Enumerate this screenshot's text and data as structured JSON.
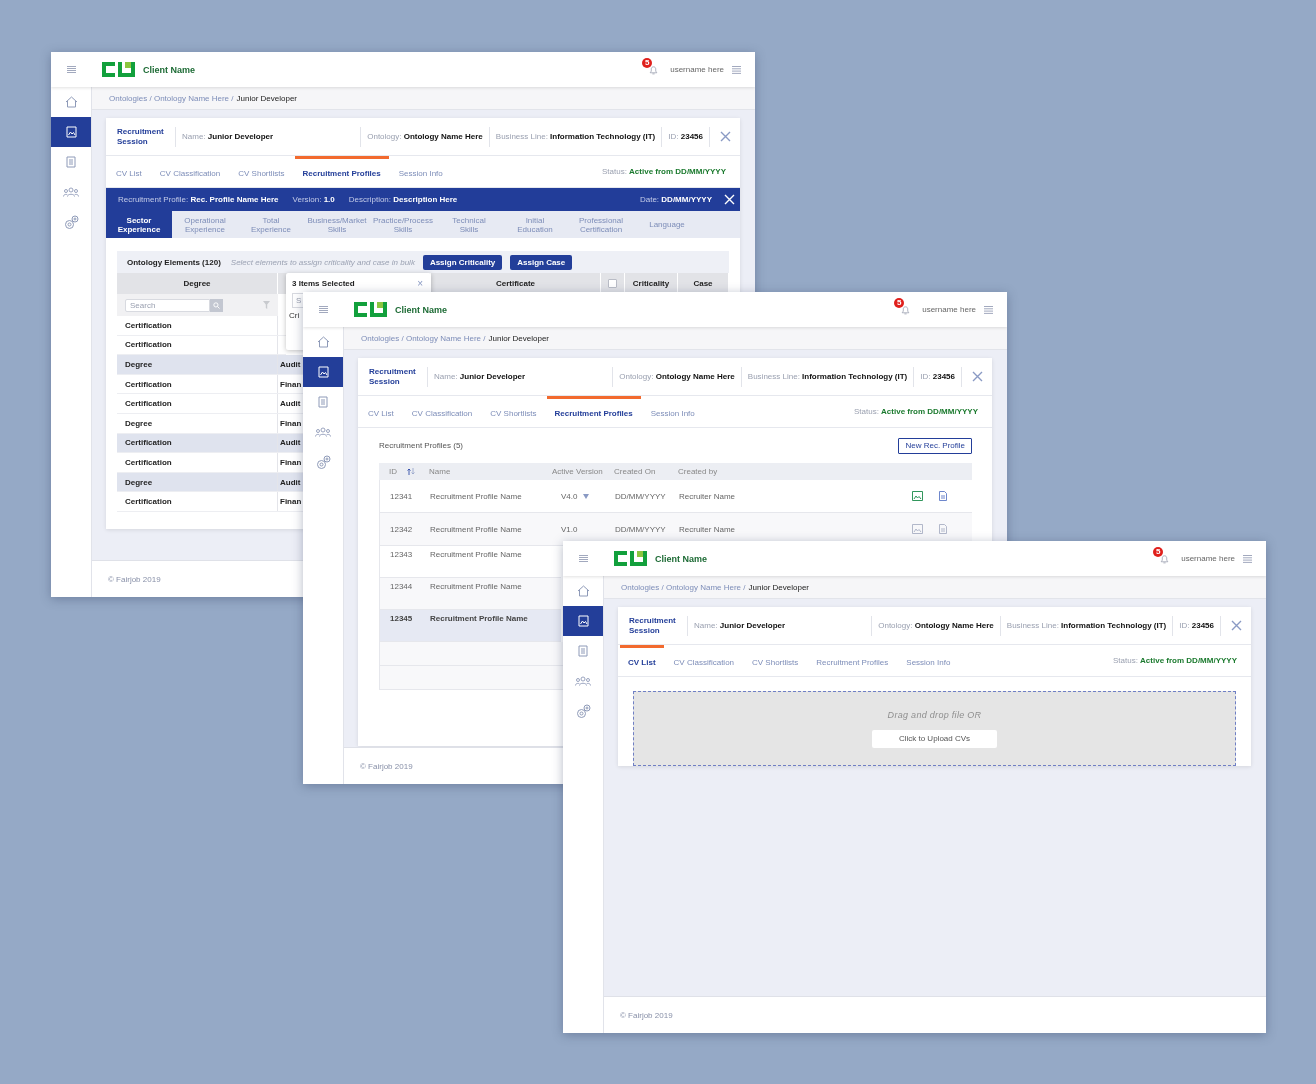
{
  "windows": [
    {
      "kind": "profile_detail",
      "header": {
        "client_name": "Client Name",
        "notifications": "5",
        "username": "username here"
      },
      "sidebar": [
        {
          "kind": "home",
          "selected": false
        },
        {
          "kind": "profile",
          "selected": true
        },
        {
          "kind": "document",
          "selected": false
        },
        {
          "kind": "people",
          "selected": false
        },
        {
          "kind": "settings",
          "selected": false
        }
      ],
      "breadcrumb": {
        "path": "Ontologies / Ontology Name Here /",
        "current": "Junior Developer"
      },
      "session": {
        "title": "Recruitment Session",
        "fields": [
          {
            "label": "Name:",
            "value": "Junior Developer"
          },
          {
            "label": "Ontology:",
            "value": "Ontology Name Here"
          },
          {
            "label": "Business Line:",
            "value": "Information Technology (IT)"
          },
          {
            "label": "ID:",
            "value": "23456"
          }
        ]
      },
      "tabs": [
        {
          "label": "CV List",
          "selected": false
        },
        {
          "label": "CV Classification",
          "selected": false
        },
        {
          "label": "CV Shortlists",
          "selected": false
        },
        {
          "label": "Recruitment Profiles",
          "selected": true
        },
        {
          "label": "Session Info",
          "selected": false
        }
      ],
      "status": {
        "label": "Status:",
        "value": "Active from DD/MM/YYYY"
      },
      "profile_bar": {
        "fields": [
          {
            "label": "Recruitment Profile:",
            "value": "Rec. Profile Name Here"
          },
          {
            "label": "Version:",
            "value": "1.0"
          },
          {
            "label": "Description:",
            "value": "Description Here"
          }
        ],
        "date": {
          "label": "Date:",
          "value": "DD/MM/YYYY"
        }
      },
      "sub_tabs": [
        {
          "label": "Sector Experience",
          "selected": true
        },
        {
          "label": "Operational Experience",
          "selected": false
        },
        {
          "label": "Total Experience",
          "selected": false
        },
        {
          "label": "Business/Market Skills",
          "selected": false
        },
        {
          "label": "Practice/Process Skills",
          "selected": false
        },
        {
          "label": "Technical Skills",
          "selected": false
        },
        {
          "label": "Initial Education",
          "selected": false
        },
        {
          "label": "Professional Certification",
          "selected": false
        },
        {
          "label": "Language",
          "selected": false
        }
      ],
      "elements": {
        "title": "Ontology Elements (120)",
        "hint": "Select elements to assign criticality and case in bulk",
        "buttons": [
          "Assign Criticality",
          "Assign Case"
        ]
      },
      "table": {
        "columns": [
          "Degree",
          "Certificate",
          "Criticality",
          "Case"
        ],
        "select_all": {
          "checked": false
        },
        "search": {
          "placeholder": "Search"
        },
        "rows": [
          {
            "column_1": "Certification",
            "selected": false
          },
          {
            "column_1": "Certification",
            "selected": false
          },
          {
            "column_1": "Degree",
            "column_2": "Audit",
            "selected": true
          },
          {
            "column_1": "Certification",
            "column_2": "Finan",
            "selected": false
          },
          {
            "column_1": "Certification",
            "column_2": "Audit",
            "selected": false
          },
          {
            "column_1": "Degree",
            "column_2": "Finan",
            "selected": false
          },
          {
            "column_1": "Certification",
            "column_2": "Audit",
            "selected": true
          },
          {
            "column_1": "Certification",
            "column_2": "Finan",
            "selected": false
          },
          {
            "column_1": "Degree",
            "column_2": "Audit",
            "selected": true
          },
          {
            "column_1": "Certification",
            "column_2": "Finan",
            "selected": false
          }
        ]
      },
      "popup": {
        "title": "3 Items Selected",
        "close": "×",
        "search_placeholder": "S",
        "label": "Cri"
      },
      "footer": "© Fairjob 2019"
    },
    {
      "kind": "profile_list",
      "header": {
        "client_name": "Client Name",
        "notifications": "5",
        "username": "username here"
      },
      "sidebar": [
        {
          "kind": "home",
          "selected": false
        },
        {
          "kind": "profile",
          "selected": true
        },
        {
          "kind": "document",
          "selected": false
        },
        {
          "kind": "people",
          "selected": false
        },
        {
          "kind": "settings",
          "selected": false
        }
      ],
      "breadcrumb": {
        "path": "Ontologies / Ontology Name Here /",
        "current": "Junior Developer"
      },
      "session": {
        "title": "Recruitment Session",
        "fields": [
          {
            "label": "Name:",
            "value": "Junior Developer"
          },
          {
            "label": "Ontology:",
            "value": "Ontology Name Here"
          },
          {
            "label": "Business Line:",
            "value": "Information Technology (IT)"
          },
          {
            "label": "ID:",
            "value": "23456"
          }
        ]
      },
      "tabs": [
        {
          "label": "CV List",
          "selected": false
        },
        {
          "label": "CV Classification",
          "selected": false
        },
        {
          "label": "CV Shortlists",
          "selected": false
        },
        {
          "label": "Recruitment Profiles",
          "selected": true
        },
        {
          "label": "Session Info",
          "selected": false
        }
      ],
      "status": {
        "label": "Status:",
        "value": "Active from DD/MM/YYYY"
      },
      "list": {
        "title": "Recruitment Profiles (5)",
        "button": "New Rec. Profile",
        "columns": [
          "ID",
          "Name",
          "Active Version",
          "Created On",
          "Created by"
        ],
        "rows": [
          {
            "id": "12341",
            "name": "Recruitment Profile Name",
            "version": "V4.0",
            "has_versions": true,
            "created_on": "DD/MM/YYYY",
            "created_by": "Recruiter Name",
            "enabled": true,
            "selected": false
          },
          {
            "id": "12342",
            "name": "Recruitment Profile Name",
            "version": "V1.0",
            "has_versions": false,
            "created_on": "DD/MM/YYYY",
            "created_by": "Recruiter Name",
            "enabled": false,
            "selected": false
          },
          {
            "id": "12343",
            "name": "Recruitment Profile Name",
            "selected": false
          },
          {
            "id": "12344",
            "name": "Recruitment Profile Name",
            "selected": false
          },
          {
            "id": "12345",
            "name": "Recruitment Profile Name",
            "selected": true
          }
        ]
      },
      "footer": "© Fairjob 2019"
    },
    {
      "kind": "cv_upload",
      "header": {
        "client_name": "Client Name",
        "notifications": "5",
        "username": "username here"
      },
      "sidebar": [
        {
          "kind": "home",
          "selected": false
        },
        {
          "kind": "profile",
          "selected": true
        },
        {
          "kind": "document",
          "selected": false
        },
        {
          "kind": "people",
          "selected": false
        },
        {
          "kind": "settings",
          "selected": false
        }
      ],
      "breadcrumb": {
        "path": "Ontologies / Ontology Name Here /",
        "current": "Junior Developer"
      },
      "session": {
        "title": "Recruitment Session",
        "fields": [
          {
            "label": "Name:",
            "value": "Junior Developer"
          },
          {
            "label": "Ontology:",
            "value": "Ontology Name Here"
          },
          {
            "label": "Business Line:",
            "value": "Information Technology (IT)"
          },
          {
            "label": "ID:",
            "value": "23456"
          }
        ]
      },
      "tabs": [
        {
          "label": "CV List",
          "selected": true
        },
        {
          "label": "CV Classification",
          "selected": false
        },
        {
          "label": "CV Shortlists",
          "selected": false
        },
        {
          "label": "Recruitment Profiles",
          "selected": false
        },
        {
          "label": "Session Info",
          "selected": false
        }
      ],
      "status": {
        "label": "Status:",
        "value": "Active from DD/MM/YYYY"
      },
      "upload": {
        "hint": "Drag and drop file OR",
        "button": "Click to Upload CVs"
      },
      "footer": "© Fairjob 2019"
    }
  ]
}
